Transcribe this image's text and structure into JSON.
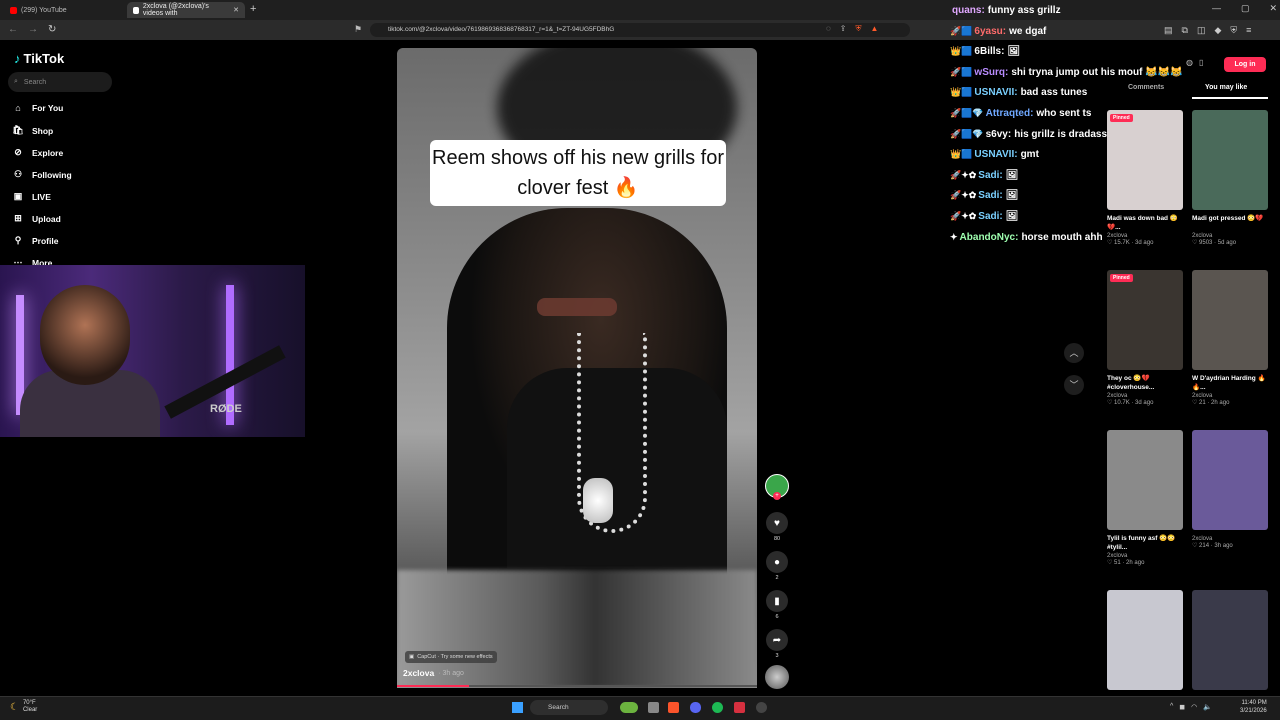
{
  "browser": {
    "tabs": [
      {
        "label": "(299) YouTube",
        "color": "#ff0000"
      },
      {
        "label": "2xclova (@2xclova)'s videos with",
        "color": "#ffffff"
      }
    ],
    "url": "tiktok.com/@2xclova/video/7619869368368768317_r=1&_t=ZT-94UG5FDBhG"
  },
  "sidebar": {
    "logo": "TikTok",
    "search_placeholder": "Search",
    "items": [
      {
        "label": "For You",
        "icon": "home-icon"
      },
      {
        "label": "Shop",
        "icon": "shop-icon"
      },
      {
        "label": "Explore",
        "icon": "compass-icon"
      },
      {
        "label": "Following",
        "icon": "following-icon"
      },
      {
        "label": "LIVE",
        "icon": "live-icon"
      },
      {
        "label": "Upload",
        "icon": "upload-icon"
      },
      {
        "label": "Profile",
        "icon": "profile-icon"
      },
      {
        "label": "More",
        "icon": "more-icon"
      }
    ]
  },
  "webcam": {
    "mic_brand": "RØDE"
  },
  "video": {
    "caption": "Reem shows off his new grills for clover fest 🔥",
    "capcut": "CapCut · Try some new effects",
    "author": "2xclova",
    "posted": "· 3h ago",
    "progress": 0.2
  },
  "actions": {
    "likes": "80",
    "comments": "2",
    "saves": "6",
    "shares": "3"
  },
  "chat": [
    {
      "user": "quans:",
      "msg": "funny ass grillz",
      "color": "#e0a8ff",
      "badges": ""
    },
    {
      "user": "6yasu:",
      "msg": "we dgaf",
      "color": "#ff6b6b",
      "badges": "🚀🟦"
    },
    {
      "user": "6Bills:",
      "msg": "🖼",
      "color": "#ffffff",
      "badges": "👑🟦"
    },
    {
      "user": "wSurq:",
      "msg": "shi tryna jump out his mouf 😹😹😹",
      "color": "#b98cff",
      "badges": "🚀🟦"
    },
    {
      "user": "USNAVII:",
      "msg": "bad ass tunes",
      "color": "#7ad0ff",
      "badges": "👑🟦"
    },
    {
      "user": "Attraqted:",
      "msg": "who sent ts",
      "color": "#6fa8ff",
      "badges": "🚀🟦💎"
    },
    {
      "user": "s6vy:",
      "msg": "his grillz is dradass dirt",
      "color": "#ffffff",
      "badges": "🚀🟦💎"
    },
    {
      "user": "USNAVII:",
      "msg": "gmt",
      "color": "#7ad0ff",
      "badges": "👑🟦"
    },
    {
      "user": "Sadi:",
      "msg": "🖼",
      "color": "#7ad0ff",
      "badges": "🚀✦✿"
    },
    {
      "user": "Sadi:",
      "msg": "🖼",
      "color": "#7ad0ff",
      "badges": "🚀✦✿"
    },
    {
      "user": "Sadi:",
      "msg": "🖼",
      "color": "#7ad0ff",
      "badges": "🚀✦✿"
    },
    {
      "user": "AbandoNyc:",
      "msg": "horse mouth ahh",
      "color": "#9fffb0",
      "badges": "✦"
    }
  ],
  "right_panel": {
    "login": "Log in",
    "tab_comments": "Comments",
    "tab_maylike": "You may like",
    "cards": [
      {
        "pinned": "Pinned",
        "title": "Madi was down bad 😳💔...",
        "author": "2xclova",
        "stats": "♡ 15.7K · 3d ago",
        "bg": "#d8d0d0"
      },
      {
        "pinned": "",
        "title": "Madi got pressed 😳💔",
        "author": "2xclova",
        "stats": "♡ 9503 · 5d ago",
        "bg": "#4a6a5a"
      },
      {
        "pinned": "Pinned",
        "title": "They oc 😳💔 #cloverhouse...",
        "author": "2xclova",
        "stats": "♡ 10.7K · 3d ago",
        "bg": "#3a3530"
      },
      {
        "pinned": "",
        "title": "W D'aydrian Harding 🔥🔥...",
        "author": "2xclova",
        "stats": "♡ 21 · 2h ago",
        "bg": "#5a5550"
      },
      {
        "pinned": "",
        "title": "Tylil is funny asf 😳😳 #tylil...",
        "author": "2xclova",
        "stats": "♡ 51 · 2h ago",
        "bg": "#8a8a8a"
      },
      {
        "pinned": "",
        "title": "",
        "author": "2xclova",
        "stats": "♡ 214 · 3h ago",
        "bg": "#6a5a9a"
      },
      {
        "pinned": "",
        "title": "",
        "author": "",
        "stats": "",
        "bg": "#c8c8d0"
      },
      {
        "pinned": "",
        "title": "",
        "author": "",
        "stats": "",
        "bg": "#3a3a4a"
      }
    ]
  },
  "taskbar": {
    "weather_temp": "70°F",
    "weather_desc": "Clear",
    "search": "Search",
    "time": "11:40 PM",
    "date": "3/21/2026"
  }
}
